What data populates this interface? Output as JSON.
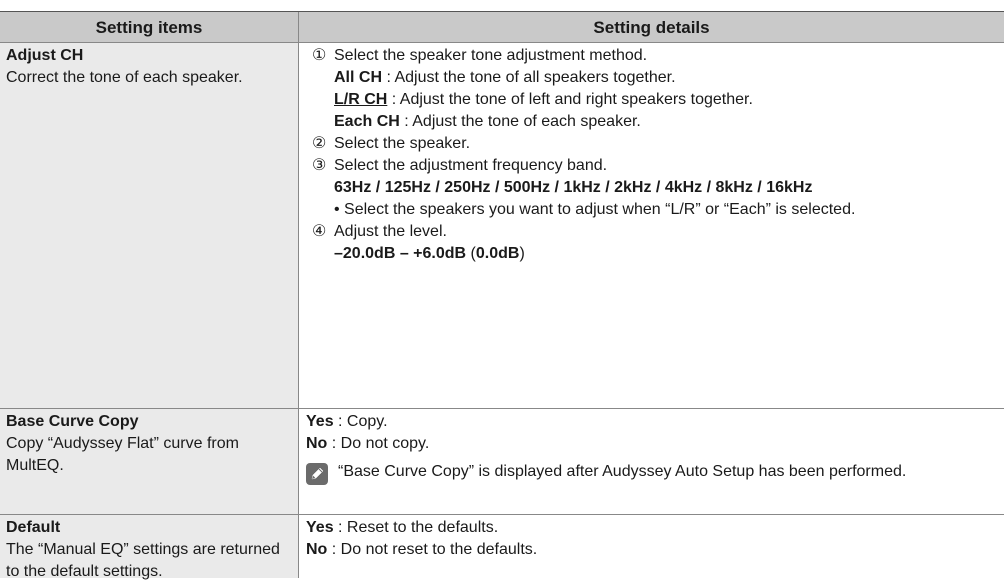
{
  "header": {
    "col1": "Setting items",
    "col2": "Setting details"
  },
  "rows": [
    {
      "name": "Adjust CH",
      "desc": "Correct the tone of each speaker.",
      "step1_num": "①",
      "step1_text": "Select the speaker tone adjustment method.",
      "opt_all_label": "All CH",
      "opt_all_text": " : Adjust the tone of all speakers together.",
      "opt_lr_label": "L/R CH",
      "opt_lr_text": " : Adjust the tone of left and right speakers together.",
      "opt_each_label": "Each CH",
      "opt_each_text": " : Adjust the tone of each speaker.",
      "step2_num": "②",
      "step2_text": "Select the speaker.",
      "step3_num": "③",
      "step3_text": "Select the adjustment frequency band.",
      "freqs": "63Hz / 125Hz / 250Hz / 500Hz / 1kHz / 2kHz / 4kHz / 8kHz / 16kHz",
      "bullet": "• Select the speakers you want to adjust when “L/R” or “Each” is selected.",
      "step4_num": "④",
      "step4_text": "Adjust the level.",
      "range": "–20.0dB – +6.0dB",
      "range_default_open": " (",
      "range_default": "0.0dB",
      "range_default_close": ")"
    },
    {
      "name": "Base Curve Copy",
      "desc": "Copy “Audyssey Flat” curve from MultEQ.",
      "yes_label": "Yes",
      "yes_text": " : Copy.",
      "no_label": "No",
      "no_text": " : Do not copy.",
      "note_icon": "pencil-note-icon",
      "note": "“Base Curve Copy” is displayed after Audyssey Auto Setup has been performed."
    },
    {
      "name": "Default",
      "desc": "The “Manual EQ” settings are returned to the default settings.",
      "yes_label": "Yes",
      "yes_text": " : Reset to the defaults.",
      "no_label": "No",
      "no_text": " : Do not reset to the defaults."
    }
  ]
}
